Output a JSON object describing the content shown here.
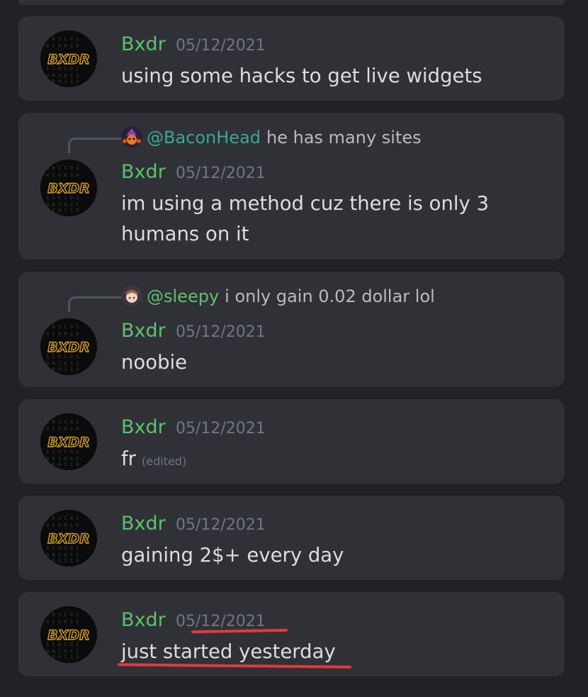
{
  "colors": {
    "background": "#202225",
    "card": "#2f3136",
    "username": "#5ec16c",
    "timestamp": "#72767d",
    "text": "#dcddde",
    "annotation": "#e5383f"
  },
  "avatar_text": "BXDR",
  "messages": [
    {
      "username": "Bxdr",
      "date": "05/12/2021",
      "text": "using some hacks to get live widgets"
    },
    {
      "reply": {
        "mention": "@BaconHead",
        "mention_color": "#3aa88f",
        "text": "he has many sites",
        "avatar_icon": "baconhead-avatar-icon"
      },
      "username": "Bxdr",
      "date": "05/12/2021",
      "text_line1": "im using a method cuz there is only 3",
      "text_line2": "humans on it"
    },
    {
      "reply": {
        "mention": "@sleepy",
        "mention_color": "#5ec16c",
        "text": "i only gain 0.02 dollar lol",
        "avatar_icon": "sleepy-avatar-icon"
      },
      "username": "Bxdr",
      "date": "05/12/2021",
      "text": "noobie"
    },
    {
      "username": "Bxdr",
      "date": "05/12/2021",
      "text": "fr",
      "edited": "(edited)"
    },
    {
      "username": "Bxdr",
      "date": "05/12/2021",
      "text": "gaining 2$+ every day"
    },
    {
      "username": "Bxdr",
      "date": "05/12/2021",
      "text": "just started yesterday",
      "underlined": true
    }
  ]
}
